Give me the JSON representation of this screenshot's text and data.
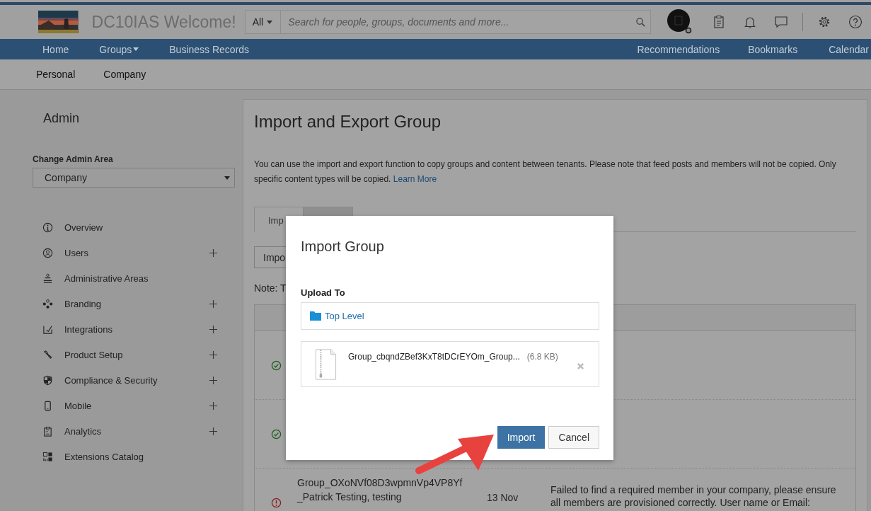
{
  "header": {
    "title": "DC10IAS Welcome!",
    "scope": "All",
    "search": {
      "placeholder": "Search for people, groups, documents and more..."
    }
  },
  "nav": {
    "left": [
      {
        "label": "Home",
        "dropdown": false
      },
      {
        "label": "Groups",
        "dropdown": true
      },
      {
        "label": "Business Records",
        "dropdown": false
      }
    ],
    "right": [
      "Recommendations",
      "Bookmarks",
      "Calendar"
    ]
  },
  "subnav": [
    "Personal",
    "Company"
  ],
  "sidebar": {
    "title": "Admin",
    "area_label": "Change Admin Area",
    "area_value": "Company",
    "items": [
      {
        "label": "Overview",
        "kind": "info",
        "expandable": false
      },
      {
        "label": "Users",
        "kind": "user",
        "expandable": true
      },
      {
        "label": "Administrative Areas",
        "kind": "hierarchy",
        "expandable": false
      },
      {
        "label": "Branding",
        "kind": "palette",
        "expandable": true
      },
      {
        "label": "Integrations",
        "kind": "integration",
        "expandable": true
      },
      {
        "label": "Product Setup",
        "kind": "wrench",
        "expandable": true
      },
      {
        "label": "Compliance & Security",
        "kind": "shield",
        "expandable": true
      },
      {
        "label": "Mobile",
        "kind": "phone",
        "expandable": true
      },
      {
        "label": "Analytics",
        "kind": "clipboard",
        "expandable": true
      },
      {
        "label": "Extensions Catalog",
        "kind": "grid",
        "expandable": false
      }
    ]
  },
  "main": {
    "title": "Import and Export Group",
    "description": "You can use the import and export function to copy groups and content between tenants. Please note that feed posts and members will not be copied. Only specific content types will be copied.",
    "learn_more": "Learn More",
    "tabs": [
      {
        "label": "Imp",
        "selected": true
      },
      {
        "selected": false
      }
    ],
    "button": "Impo",
    "note": "Note: T",
    "rows": [
      {
        "kind": "success"
      },
      {
        "kind": "success"
      },
      {
        "kind": "error",
        "name": [
          "Group_OXoNVf08D3wpmnVp4VP8Yf",
          "_Patrick Testing, testing"
        ],
        "date": "13 Nov",
        "message": "Failed to find a required member in your company, please ensure all members are provisioned correctly. User name or Email:"
      }
    ]
  },
  "dialog": {
    "title": "Import Group",
    "upload_label": "Upload To",
    "folder": "Top Level",
    "file": {
      "name": "Group_cbqndZBef3KxT8tDCrEYOm_Group...",
      "size": "(6.8 KB)"
    },
    "buttons": [
      {
        "label": "Import",
        "primary": true
      },
      {
        "label": "Cancel",
        "primary": false
      }
    ]
  }
}
